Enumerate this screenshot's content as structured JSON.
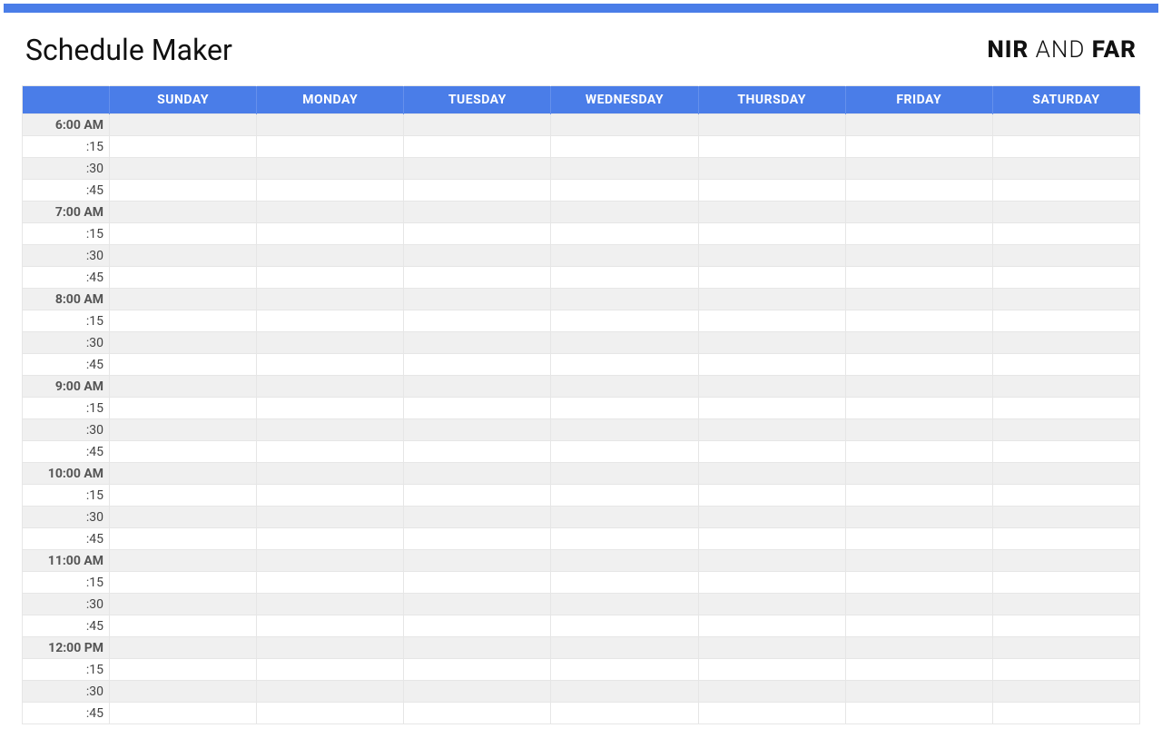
{
  "header": {
    "title": "Schedule Maker",
    "brand_part1": "NIR",
    "brand_part2": " AND ",
    "brand_part3": "FAR"
  },
  "days": [
    "SUNDAY",
    "MONDAY",
    "TUESDAY",
    "WEDNESDAY",
    "THURSDAY",
    "FRIDAY",
    "SATURDAY"
  ],
  "time_rows": [
    {
      "label": "6:00 AM",
      "hour": true
    },
    {
      "label": ":15",
      "hour": false
    },
    {
      "label": ":30",
      "hour": false
    },
    {
      "label": ":45",
      "hour": false
    },
    {
      "label": "7:00 AM",
      "hour": true
    },
    {
      "label": ":15",
      "hour": false
    },
    {
      "label": ":30",
      "hour": false
    },
    {
      "label": ":45",
      "hour": false
    },
    {
      "label": "8:00 AM",
      "hour": true
    },
    {
      "label": ":15",
      "hour": false
    },
    {
      "label": ":30",
      "hour": false
    },
    {
      "label": ":45",
      "hour": false
    },
    {
      "label": "9:00 AM",
      "hour": true
    },
    {
      "label": ":15",
      "hour": false
    },
    {
      "label": ":30",
      "hour": false
    },
    {
      "label": ":45",
      "hour": false
    },
    {
      "label": "10:00 AM",
      "hour": true
    },
    {
      "label": ":15",
      "hour": false
    },
    {
      "label": ":30",
      "hour": false
    },
    {
      "label": ":45",
      "hour": false
    },
    {
      "label": "11:00 AM",
      "hour": true
    },
    {
      "label": ":15",
      "hour": false
    },
    {
      "label": ":30",
      "hour": false
    },
    {
      "label": ":45",
      "hour": false
    },
    {
      "label": "12:00 PM",
      "hour": true
    },
    {
      "label": ":15",
      "hour": false
    },
    {
      "label": ":30",
      "hour": false
    },
    {
      "label": ":45",
      "hour": false
    }
  ]
}
